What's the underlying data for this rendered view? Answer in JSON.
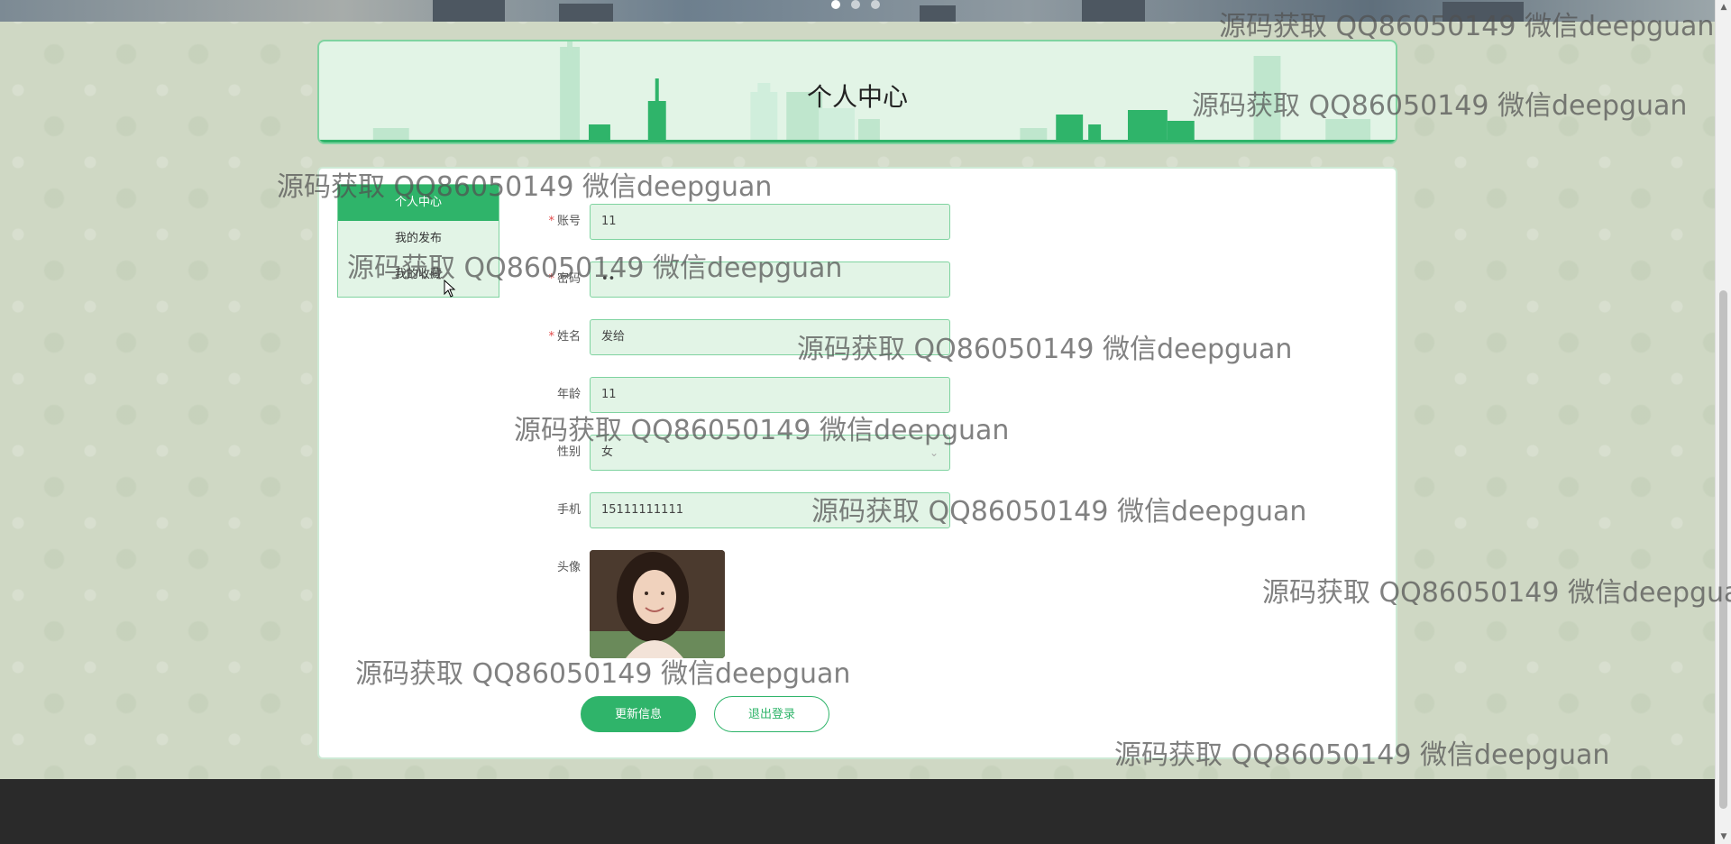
{
  "page": {
    "title": "个人中心"
  },
  "banner": {
    "slides": 3,
    "active_index": 0
  },
  "sidebar": {
    "items": [
      {
        "label": "个人中心",
        "active": true
      },
      {
        "label": "我的发布",
        "active": false
      },
      {
        "label": "我的收藏",
        "active": false
      }
    ]
  },
  "form": {
    "fields": [
      {
        "label": "账号",
        "required": true,
        "value": "11"
      },
      {
        "label": "密码",
        "required": true,
        "value": "••"
      },
      {
        "label": "姓名",
        "required": true,
        "value": "发给"
      },
      {
        "label": "年龄",
        "required": false,
        "value": "11"
      },
      {
        "label": "性别",
        "required": false,
        "value": "女",
        "type": "select"
      },
      {
        "label": "手机",
        "required": false,
        "value": "15111111111"
      }
    ],
    "avatar_label": "头像",
    "update_button": "更新信息",
    "logout_button": "退出登录"
  },
  "watermark": {
    "text": "源码获取 QQ86050149 微信deepguan",
    "text_cut": "源码获取 QQ86050149 微信deepgua"
  },
  "colors": {
    "accent": "#2fb46a",
    "field_bg": "#e2f4e6",
    "field_border": "#7fd3a0",
    "footer": "#2a2a2a"
  }
}
